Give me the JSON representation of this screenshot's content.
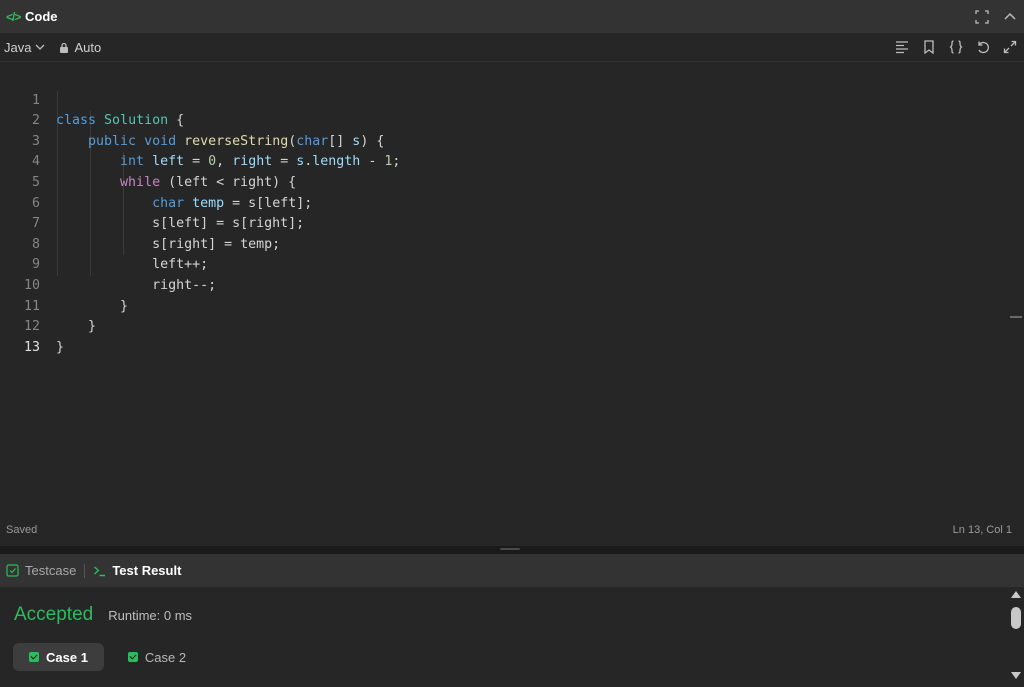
{
  "header": {
    "title": "Code",
    "icon": "code-brackets-icon"
  },
  "toolbar": {
    "language": "Java",
    "mode": "Auto",
    "right_icons": [
      "format-icon",
      "bookmark-icon",
      "braces-icon",
      "undo-icon",
      "expand-icon"
    ]
  },
  "editor": {
    "active_line": "13",
    "lines": [
      {
        "n": "1"
      },
      {
        "n": "2"
      },
      {
        "n": "3"
      },
      {
        "n": "4"
      },
      {
        "n": "5"
      },
      {
        "n": "6"
      },
      {
        "n": "7"
      },
      {
        "n": "8"
      },
      {
        "n": "9"
      },
      {
        "n": "10"
      },
      {
        "n": "11"
      },
      {
        "n": "12"
      },
      {
        "n": "13"
      }
    ],
    "code": {
      "l1": [
        "class ",
        "Solution",
        " {"
      ],
      "l2": [
        "public",
        " ",
        "void",
        " ",
        "reverseString",
        "(",
        "char",
        "[] ",
        "s",
        ") {"
      ],
      "l3": [
        "int",
        " ",
        "left",
        " = ",
        "0",
        ", ",
        "right",
        " = ",
        "s",
        ".",
        "length",
        " - ",
        "1",
        ";"
      ],
      "l4": [
        "while",
        " (left < right) {"
      ],
      "l5": [
        "char",
        " ",
        "temp",
        " = s[left];"
      ],
      "l6": [
        "s[left] = s[right];"
      ],
      "l7": [
        "s[right] = temp;"
      ],
      "l8": [
        "left++;"
      ],
      "l9": [
        "right--;"
      ],
      "l10": [
        "}"
      ],
      "l11": [
        "}"
      ],
      "l12": [
        "}"
      ]
    }
  },
  "status": {
    "saved": "Saved",
    "position": "Ln 13, Col 1"
  },
  "results": {
    "tab_testcase": "Testcase",
    "tab_result": "Test Result",
    "verdict": "Accepted",
    "runtime": "Runtime: 0 ms",
    "cases": [
      "Case 1",
      "Case 2"
    ]
  },
  "colors": {
    "accent_green": "#2cbb5d",
    "panel_bg": "#262626",
    "header_bg": "#333333"
  }
}
